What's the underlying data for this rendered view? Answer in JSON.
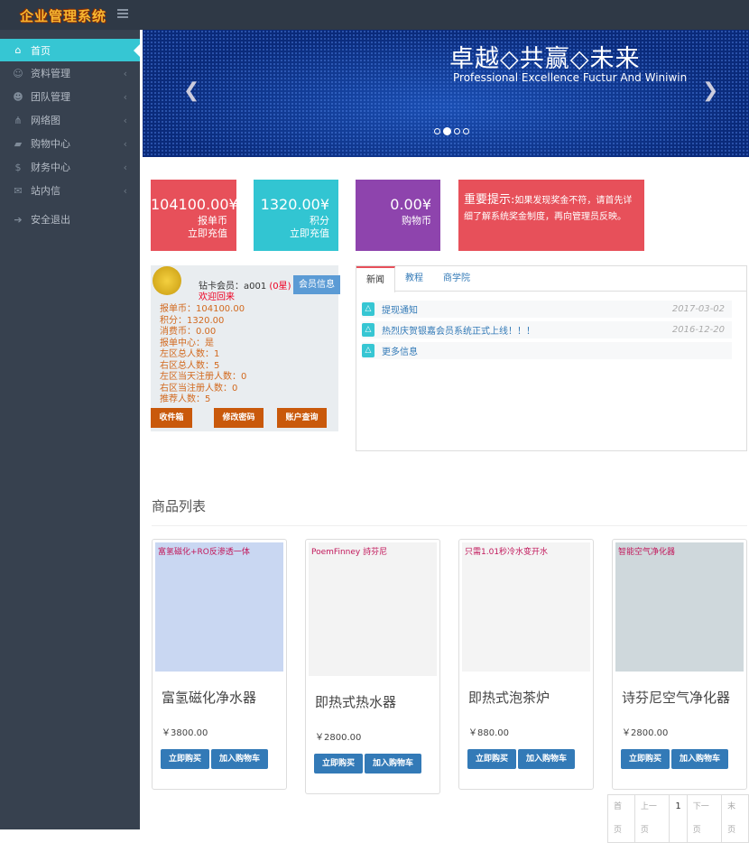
{
  "header": {
    "logo": "企业管理系统"
  },
  "sidebar": {
    "items": [
      {
        "label": "首页",
        "icon": "home-icon",
        "glyph": "⌂"
      },
      {
        "label": "资料管理",
        "icon": "user-icon",
        "glyph": "☺"
      },
      {
        "label": "团队管理",
        "icon": "users-icon",
        "glyph": "☻"
      },
      {
        "label": "网络图",
        "icon": "sitemap-icon",
        "glyph": "⋔"
      },
      {
        "label": "购物中心",
        "icon": "truck-icon",
        "glyph": "▰"
      },
      {
        "label": "财务中心",
        "icon": "dollar-icon",
        "glyph": "$"
      },
      {
        "label": "站内信",
        "icon": "envelope-icon",
        "glyph": "✉"
      },
      {
        "label": "安全退出",
        "icon": "logout-icon",
        "glyph": "➔"
      }
    ]
  },
  "banner": {
    "title": "卓越◇共赢◇未来",
    "subtitle": "Professional Excellence Fuctur And Winiwin",
    "slides": 4,
    "active_slide": 2
  },
  "stats": [
    {
      "value": "104100.00¥",
      "label": "报单币",
      "action": "立即充值",
      "color": "#e7505a"
    },
    {
      "value": "1320.00¥",
      "label": "积分",
      "action": "立即充值",
      "color": "#32c5d2"
    },
    {
      "value": "0.00¥",
      "label": "购物币",
      "action": "",
      "color": "#8e44ad"
    }
  ],
  "notice": {
    "title": "重要提示:",
    "text": "如果发现奖金不符，请首先详细了解系统奖金制度，再向管理员反映。"
  },
  "member": {
    "level": "钻卡会员",
    "sep": "：",
    "id": "a001",
    "stars": "(0星)",
    "welcome": "欢迎回来",
    "info_button": "会员信息",
    "details": [
      "报单币：104100.00",
      "积分：1320.00",
      "消费币：0.00",
      "报单中心：是",
      "左区总人数：1",
      "右区总人数：5",
      "左区当天注册人数：0",
      "右区当注册人数：0",
      "推荐人数：5"
    ],
    "buttons": [
      "收件箱",
      "修改密码",
      "账户查询"
    ]
  },
  "news": {
    "tabs": [
      "新闻",
      "教程",
      "商学院"
    ],
    "items": [
      {
        "title": "提现通知",
        "date": "2017-03-02"
      },
      {
        "title": "热烈庆贺银嘉会员系统正式上线！！！",
        "date": "2016-12-20"
      },
      {
        "title": "更多信息",
        "date": ""
      }
    ]
  },
  "products": {
    "title": "商品列表",
    "buy": "立即购买",
    "cart": "加入购物车",
    "items": [
      {
        "name": "富氢磁化净水器",
        "price": "￥3800.00",
        "img_text": "富氢磁化+RO反渗透一体",
        "img_color": "#c9d7f2"
      },
      {
        "name": "即热式热水器",
        "price": "￥2800.00",
        "img_text": "PoemFinney 詩芬尼",
        "img_color": "#f3f3f3"
      },
      {
        "name": "即热式泡茶炉",
        "price": "￥880.00",
        "img_text": "只需1.01秒冷水变开水",
        "img_color": "#f4f4f4"
      },
      {
        "name": "诗芬尼空气净化器",
        "price": "￥2800.00",
        "img_text": "智能空气净化器",
        "img_color": "#cfd8dc"
      }
    ]
  },
  "pagination": [
    "首页",
    "上一页",
    "1",
    "下一页",
    "末页"
  ]
}
